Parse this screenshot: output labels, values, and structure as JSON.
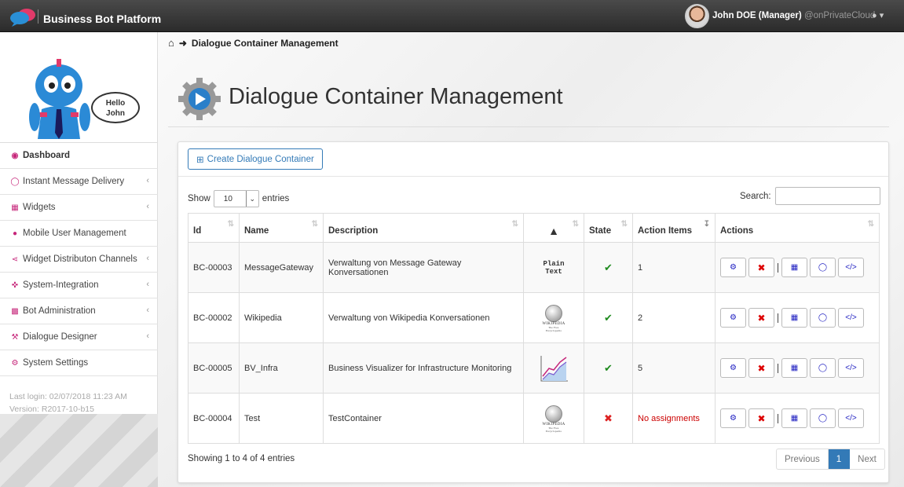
{
  "header": {
    "brand": "Business Bot Platform",
    "user_name": "John DOE (Manager)",
    "user_org": "@onPrivateCloud"
  },
  "sidebar": {
    "greeting_line1": "Hello",
    "greeting_line2": "John",
    "items": [
      {
        "label": "Dashboard",
        "icon": "dashboard-icon",
        "active": true
      },
      {
        "label": "Instant Message Delivery",
        "icon": "chat-bubble-icon",
        "expandable": true
      },
      {
        "label": "Widgets",
        "icon": "cubes-icon",
        "expandable": true
      },
      {
        "label": "Mobile User Management",
        "icon": "users-icon"
      },
      {
        "label": "Widget Distributon Channels",
        "icon": "share-icon",
        "expandable": true
      },
      {
        "label": "System-Integration",
        "icon": "crosshair-icon",
        "expandable": true
      },
      {
        "label": "Bot Administration",
        "icon": "sitemap-icon",
        "expandable": true
      },
      {
        "label": "Dialogue Designer",
        "icon": "wrench-icon",
        "expandable": true
      },
      {
        "label": "System Settings",
        "icon": "gear-icon"
      }
    ],
    "last_login": "Last login: 02/07/2018 11:23 AM",
    "version": "Version: R2017-10-b15"
  },
  "breadcrumb": {
    "current": "Dialogue Container Management"
  },
  "page": {
    "title": "Dialogue Container Management"
  },
  "panel": {
    "create_label": "Create Dialogue Container",
    "show_label": "Show",
    "entries_label": "entries",
    "page_length": "10",
    "search_label": "Search:",
    "search_value": "",
    "columns": [
      "Id",
      "Name",
      "Description",
      "",
      "State",
      "Action Items",
      "Actions"
    ],
    "rows": [
      {
        "id": "BC-00003",
        "name": "MessageGateway",
        "description": "Verwaltung von Message Gateway Konversationen",
        "channel": "plain-text",
        "channel_line1": "Plain",
        "channel_line2": "Text",
        "state": "active",
        "action_items": "1"
      },
      {
        "id": "BC-00002",
        "name": "Wikipedia",
        "description": "Verwaltung von Wikipedia Konversationen",
        "channel": "wikipedia",
        "channel_line1": "WIKIPEDIA",
        "channel_line2": "The Free Encyclopedia",
        "state": "active",
        "action_items": "2"
      },
      {
        "id": "BC-00005",
        "name": "BV_Infra",
        "description": "Business Visualizer for Infrastructure Monitoring",
        "channel": "chart",
        "state": "active",
        "action_items": "5"
      },
      {
        "id": "BC-00004",
        "name": "Test",
        "description": "TestContainer",
        "channel": "wikipedia",
        "channel_line1": "WIKIPEDIA",
        "channel_line2": "The Free Encyclopedia",
        "state": "inactive",
        "action_items": "No assignments"
      }
    ],
    "info": "Showing 1 to 4 of 4 entries",
    "pager": {
      "previous": "Previous",
      "current": "1",
      "next": "Next"
    }
  }
}
